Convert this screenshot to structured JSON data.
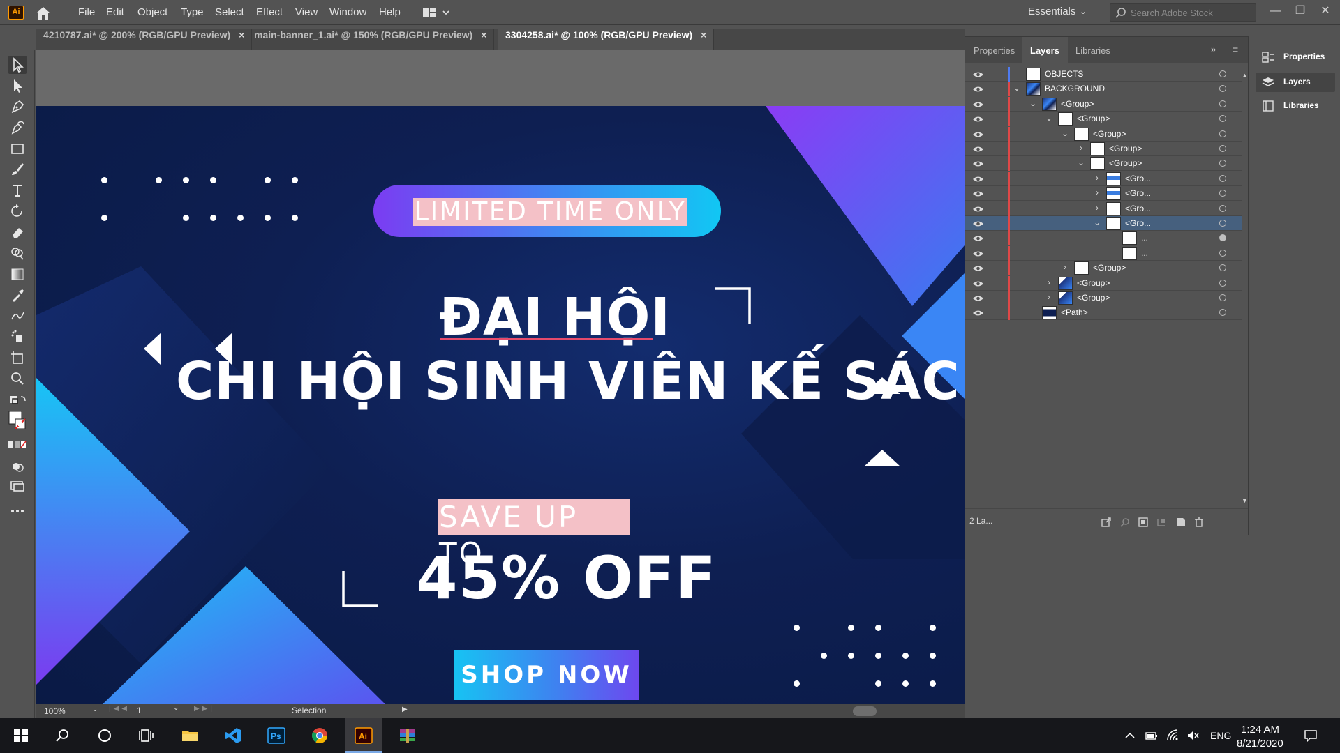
{
  "app": {
    "logo": "Ai",
    "menu": [
      "File",
      "Edit",
      "Object",
      "Type",
      "Select",
      "Effect",
      "View",
      "Window",
      "Help"
    ],
    "workspace": "Essentials",
    "search_placeholder": "Search Adobe Stock"
  },
  "tabs": [
    {
      "label": "4210787.ai* @ 200% (RGB/GPU Preview)",
      "active": false
    },
    {
      "label": "main-banner_1.ai* @ 150% (RGB/GPU Preview)",
      "active": false
    },
    {
      "label": "3304258.ai* @ 100% (RGB/GPU Preview)",
      "active": true
    }
  ],
  "tab_close": "×",
  "artwork": {
    "pill_text": "LIMITED TIME ONLY",
    "title_line1": "ĐẠI HỘI",
    "title_line2": "CHI HỘI SINH VIÊN KẾ SÁCH",
    "save_text": "SAVE UP TO",
    "offer_text": "45% OFF",
    "button_text": "SHOP NOW"
  },
  "status": {
    "zoom": "100%",
    "artboard": "1",
    "tool": "Selection"
  },
  "panel": {
    "tabs": [
      "Properties",
      "Layers",
      "Libraries"
    ],
    "active_tab": "Layers",
    "footer_count": "2 La...",
    "layers": [
      {
        "name": "OBJECTS",
        "indent": 0,
        "twist": "",
        "color": "#4f7bf0",
        "thumb": "white",
        "selected": false,
        "target_filled": false
      },
      {
        "name": "BACKGROUND",
        "indent": 0,
        "twist": "⌄",
        "color": "#e04848",
        "thumb": "banner",
        "selected": false,
        "target_filled": false
      },
      {
        "name": "<Group>",
        "indent": 1,
        "twist": "⌄",
        "color": "#e04848",
        "thumb": "banner",
        "selected": false,
        "target_filled": false
      },
      {
        "name": "<Group>",
        "indent": 2,
        "twist": "⌄",
        "color": "#e04848",
        "thumb": "white",
        "selected": false,
        "target_filled": false
      },
      {
        "name": "<Group>",
        "indent": 3,
        "twist": "⌄",
        "color": "#e04848",
        "thumb": "white",
        "selected": false,
        "target_filled": false
      },
      {
        "name": "<Group>",
        "indent": 4,
        "twist": "›",
        "color": "#e04848",
        "thumb": "white",
        "selected": false,
        "target_filled": false
      },
      {
        "name": "<Group>",
        "indent": 4,
        "twist": "⌄",
        "color": "#e04848",
        "thumb": "white",
        "selected": false,
        "target_filled": false
      },
      {
        "name": "<Gro...",
        "indent": 5,
        "twist": "›",
        "color": "#e04848",
        "thumb": "blue",
        "selected": false,
        "target_filled": false
      },
      {
        "name": "<Gro...",
        "indent": 5,
        "twist": "›",
        "color": "#e04848",
        "thumb": "blue",
        "selected": false,
        "target_filled": false
      },
      {
        "name": "<Gro...",
        "indent": 5,
        "twist": "›",
        "color": "#e04848",
        "thumb": "white",
        "selected": false,
        "target_filled": false
      },
      {
        "name": "<Gro...",
        "indent": 5,
        "twist": "⌄",
        "color": "#e04848",
        "thumb": "white",
        "selected": true,
        "target_filled": false
      },
      {
        "name": "...",
        "indent": 6,
        "twist": "",
        "color": "#e04848",
        "thumb": "white",
        "selected": false,
        "target_filled": true
      },
      {
        "name": "...",
        "indent": 6,
        "twist": "",
        "color": "#e04848",
        "thumb": "white",
        "selected": false,
        "target_filled": false
      },
      {
        "name": "<Group>",
        "indent": 3,
        "twist": "›",
        "color": "#e04848",
        "thumb": "white",
        "selected": false,
        "target_filled": false
      },
      {
        "name": "<Group>",
        "indent": 2,
        "twist": "›",
        "color": "#e04848",
        "thumb": "dark",
        "selected": false,
        "target_filled": false
      },
      {
        "name": "<Group>",
        "indent": 2,
        "twist": "›",
        "color": "#e04848",
        "thumb": "dark",
        "selected": false,
        "target_filled": false
      },
      {
        "name": "<Path>",
        "indent": 1,
        "twist": "",
        "color": "#e04848",
        "thumb": "navy",
        "selected": false,
        "target_filled": false
      }
    ]
  },
  "dock": [
    "Properties",
    "Layers",
    "Libraries"
  ],
  "taskbar": {
    "time": "1:24 AM",
    "date": "8/21/2020",
    "lang": "ENG"
  },
  "colors": {
    "accent": "#ff9a00",
    "artboard_bg": "#0e1f52",
    "pink_highlight": "#f4c1c7",
    "layer_selected": "#46607e"
  }
}
